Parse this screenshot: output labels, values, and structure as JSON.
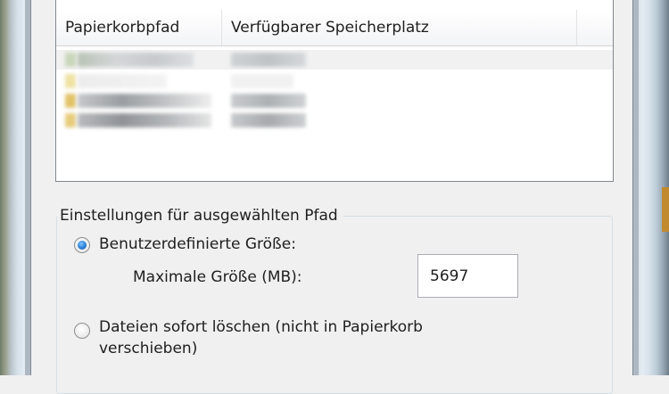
{
  "listview": {
    "columns": [
      "Papierkorbpfad",
      "Verfügbarer Speicherplatz"
    ],
    "rows": [
      {
        "path": "(blurred)",
        "space": "(blurred)",
        "highlighted": true
      },
      {
        "path": "(blurred)",
        "space": "(blurred)",
        "highlighted": false
      },
      {
        "path": "(blurred)",
        "space": "(blurred)",
        "highlighted": false
      },
      {
        "path": "(blurred)",
        "space": "(blurred)",
        "highlighted": false
      }
    ]
  },
  "settings": {
    "group_title": "Einstellungen für ausgewählten Pfad",
    "custom_size_label": "Benutzerdefinierte Größe:",
    "max_size_label": "Maximale Größe (MB):",
    "max_size_value": "5697",
    "delete_immediately_label_line1": "Dateien sofort löschen (nicht in Papierkorb",
    "delete_immediately_label_line2": "verschieben)",
    "selected_option": "custom_size"
  },
  "colors": {
    "radio_selected": "#2a7fd4",
    "highlight_row": "#f1f1f1"
  }
}
